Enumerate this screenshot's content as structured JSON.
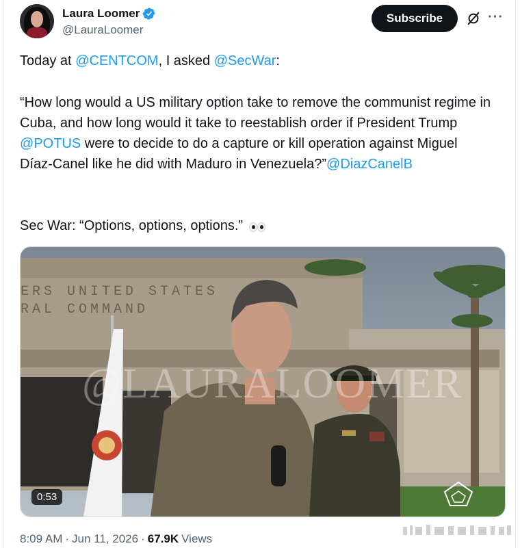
{
  "author": {
    "name": "Laura Loomer",
    "handle": "@LauraLoomer"
  },
  "actions": {
    "subscribe_label": "Subscribe",
    "grok_icon": "grok-slash-icon",
    "more_label": "···"
  },
  "tweet": {
    "line1": {
      "p1": "Today at ",
      "m1": "@CENTCOM",
      "p2": ", I asked ",
      "m2": "@SecWar",
      "p3": ":"
    },
    "quote": {
      "p1": "“How long would a US military option take to remove the communist regime in Cuba, and how long would it take to reestablish order if President Trump ",
      "m1": "@POTUS",
      "p2": " were to decide to do a capture or kill operation against Miguel Díaz-Canel like he did with Maduro in Venezuela?”",
      "m2": "@DiazCanelB"
    },
    "answer": "Sec War: “Options, options, options.”"
  },
  "media": {
    "duration": "0:53",
    "building_sign_line1": "ERS  UNITED  STATES",
    "building_sign_line2": "RAL  COMMAND",
    "watermark": "@LAURALOOMER"
  },
  "footer": {
    "time": "8:09 AM",
    "sep": "·",
    "date": "Jun 11, 2026",
    "sep2": "·",
    "views_count": "67.9K",
    "views_label": "Views"
  },
  "colors": {
    "link": "#1d9bf0",
    "text": "#0f1419",
    "muted": "#536471",
    "verified": "#1d9bf0"
  }
}
